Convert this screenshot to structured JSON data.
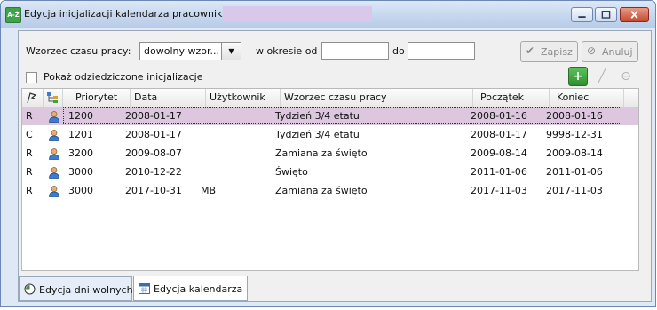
{
  "window": {
    "title": "Edycja inicjalizacji kalendarza  pracownik ",
    "app_icon": "A-Ż"
  },
  "toolbar": {
    "pattern_label": "Wzorzec czasu pracy:",
    "pattern_value": "dowolny wzor...",
    "period_from_label": "w okresie od",
    "period_to_label": "do",
    "from_value": "",
    "to_value": "",
    "save_label": "Zapisz",
    "cancel_label": "Anuluj",
    "show_inherited_label": "Pokaż odziedziczone inicjalizacje",
    "show_inherited_checked": false
  },
  "table": {
    "columns": [
      "",
      "",
      "Priorytet",
      "Data",
      "Użytkownik",
      "Wzorzec czasu pracy",
      "Początek",
      "Koniec"
    ],
    "rows": [
      {
        "type": "R",
        "priority": "1200",
        "date": "2008-01-17",
        "user": "",
        "pattern": "Tydzień 3/4 etatu",
        "start": "2008-01-16",
        "end": "2008-01-16",
        "selected": true
      },
      {
        "type": "C",
        "priority": "1201",
        "date": "2008-01-17",
        "user": "",
        "pattern": "Tydzień 3/4 etatu",
        "start": "2008-01-17",
        "end": "9998-12-31",
        "selected": false
      },
      {
        "type": "R",
        "priority": "3200",
        "date": "2009-08-07",
        "user": "",
        "pattern": "Zamiana za święto",
        "start": "2009-08-14",
        "end": "2009-08-14",
        "selected": false
      },
      {
        "type": "R",
        "priority": "3000",
        "date": "2010-12-22",
        "user": "",
        "pattern": "Święto",
        "start": "2011-01-06",
        "end": "2011-01-06",
        "selected": false
      },
      {
        "type": "R",
        "priority": "3000",
        "date": "2017-10-31",
        "user": "MB",
        "pattern": "Zamiana za święto",
        "start": "2017-11-03",
        "end": "2017-11-03",
        "selected": false
      }
    ]
  },
  "tabs": [
    {
      "label": "Edycja dni wolnych",
      "icon": "clock-icon",
      "active": false
    },
    {
      "label": "Edycja kalendarza",
      "icon": "calendar-icon",
      "active": true
    }
  ],
  "colors": {
    "selected_row": "#dcc7de",
    "add_green": "#3aa33a",
    "title_bg": "#c6d7ee"
  }
}
